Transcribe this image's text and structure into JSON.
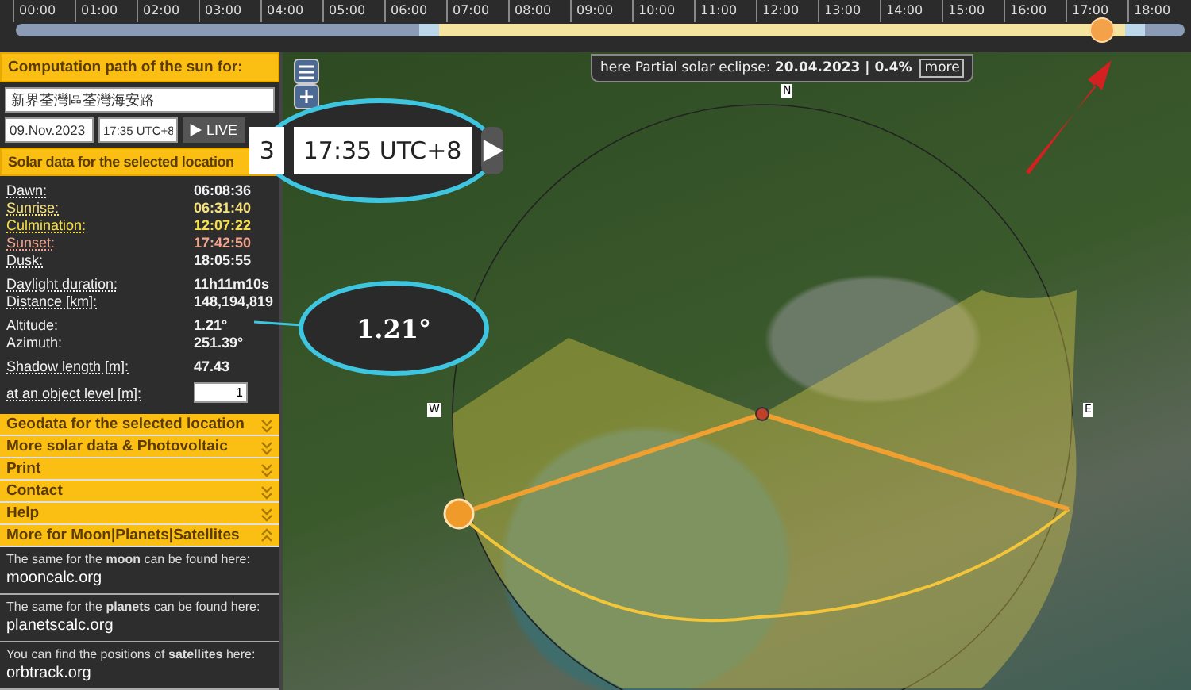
{
  "timeline": {
    "hours": [
      "00:00",
      "01:00",
      "02:00",
      "03:00",
      "04:00",
      "05:00",
      "06:00",
      "07:00",
      "08:00",
      "09:00",
      "10:00",
      "11:00",
      "12:00",
      "13:00",
      "14:00",
      "15:00",
      "16:00",
      "17:00",
      "18:00"
    ],
    "level": 0.93
  },
  "computation": {
    "title": "Computation path of the sun for:",
    "address": "新界荃灣區荃灣海安路",
    "date": "09.Nov.2023",
    "time": "17:35 UTC+8",
    "live_button": "LIVE"
  },
  "solar": {
    "title": "Solar data for the selected location",
    "groups": [
      [
        {
          "label": "Dawn:",
          "value": "06:08:36",
          "underlined": true,
          "color": "#f2f2f2"
        },
        {
          "label": "Sunrise:",
          "value": "06:31:40",
          "underlined": true,
          "color": "#f6e27c"
        },
        {
          "label": "Culmination:",
          "value": "12:07:22",
          "underlined": true,
          "color": "#f8e04c"
        },
        {
          "label": "Sunset:",
          "value": "17:42:50",
          "underlined": true,
          "color": "#f2a58e"
        },
        {
          "label": "Dusk:",
          "value": "18:05:55",
          "underlined": true,
          "color": "#f2f2f2"
        }
      ],
      [
        {
          "label": "Daylight duration:",
          "value": "11h11m10s",
          "underlined": true,
          "color": "#f2f2f2"
        },
        {
          "label": "Distance [km]:",
          "value": "148,194,819",
          "underlined": true,
          "color": "#f2f2f2"
        }
      ],
      [
        {
          "label": "Altitude:",
          "value": "1.21°",
          "underlined": false,
          "color": "#f2f2f2"
        },
        {
          "label": "Azimuth:",
          "value": "251.39°",
          "underlined": false,
          "color": "#f2f2f2"
        }
      ],
      [
        {
          "label": "Shadow length [m]:",
          "value": "47.43",
          "underlined": true,
          "color": "#f2f2f2"
        }
      ]
    ],
    "object_level": {
      "label": "at an object level [m]:",
      "value": "1"
    }
  },
  "accordion": [
    {
      "label": "Geodata for the selected location",
      "expanded": false
    },
    {
      "label": "More solar data & Photovoltaic",
      "expanded": false
    },
    {
      "label": "Print",
      "expanded": false
    },
    {
      "label": "Contact",
      "expanded": false
    },
    {
      "label": "Help",
      "expanded": false
    },
    {
      "label": "More for Moon|Planets|Satellites",
      "expanded": true
    }
  ],
  "more_links": [
    {
      "text": "The same for the **moon** can be found here:",
      "link": "mooncalc.org"
    },
    {
      "text": "The same for the **planets** can be found here:",
      "link": "planetscalc.org"
    },
    {
      "text": "You can find the positions of **satellites** here:",
      "link": "orbtrack.org"
    }
  ],
  "map": {
    "eclipse": {
      "text": "here Partial solar eclipse: **20.04.2023 | 0.4%**",
      "button": "more"
    },
    "compass": {
      "north": "N",
      "west": "W",
      "east": "E"
    }
  },
  "callouts": {
    "date_fragment": "3",
    "time": "17:35 UTC+8",
    "altitude": "1.21°"
  }
}
